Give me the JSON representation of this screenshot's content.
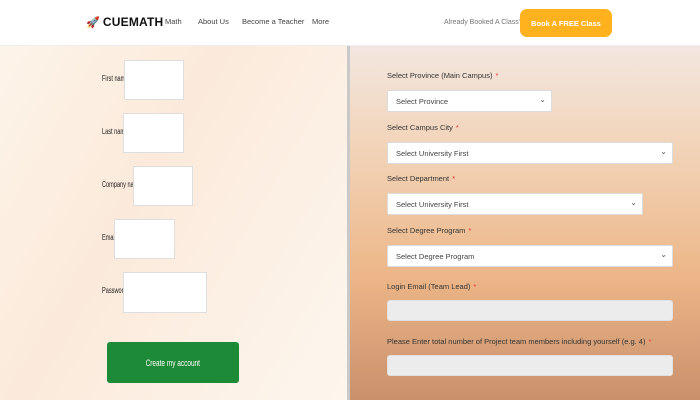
{
  "header": {
    "brand": "CUEMATH",
    "nav": [
      "Math",
      "About Us",
      "Become a Teacher",
      "More"
    ],
    "booked_text": "Already Booked A Class?",
    "cta_label": "Book A FREE Class"
  },
  "left_form": {
    "first_name_label": "First name",
    "last_name_label": "Last name",
    "company_label": "Company name",
    "email_label": "Email",
    "password_label": "Password",
    "submit_label": "Create my account"
  },
  "right_form": {
    "province_label": "Select Province (Main Campus)",
    "province_value": "Select Province",
    "city_label": "Select Campus City",
    "city_value": "Select University First",
    "department_label": "Select Department",
    "department_value": "Select University First",
    "degree_label": "Select Degree Program",
    "degree_value": "Select Degree Program",
    "login_email_label": "Login Email (Team Lead)",
    "members_label": "Please Enter total number of Project team members including yourself (e.g. 4)",
    "required_mark": "*"
  },
  "colors": {
    "accent": "#ffb21e",
    "submit": "#1d8a37",
    "required": "#e53935"
  }
}
